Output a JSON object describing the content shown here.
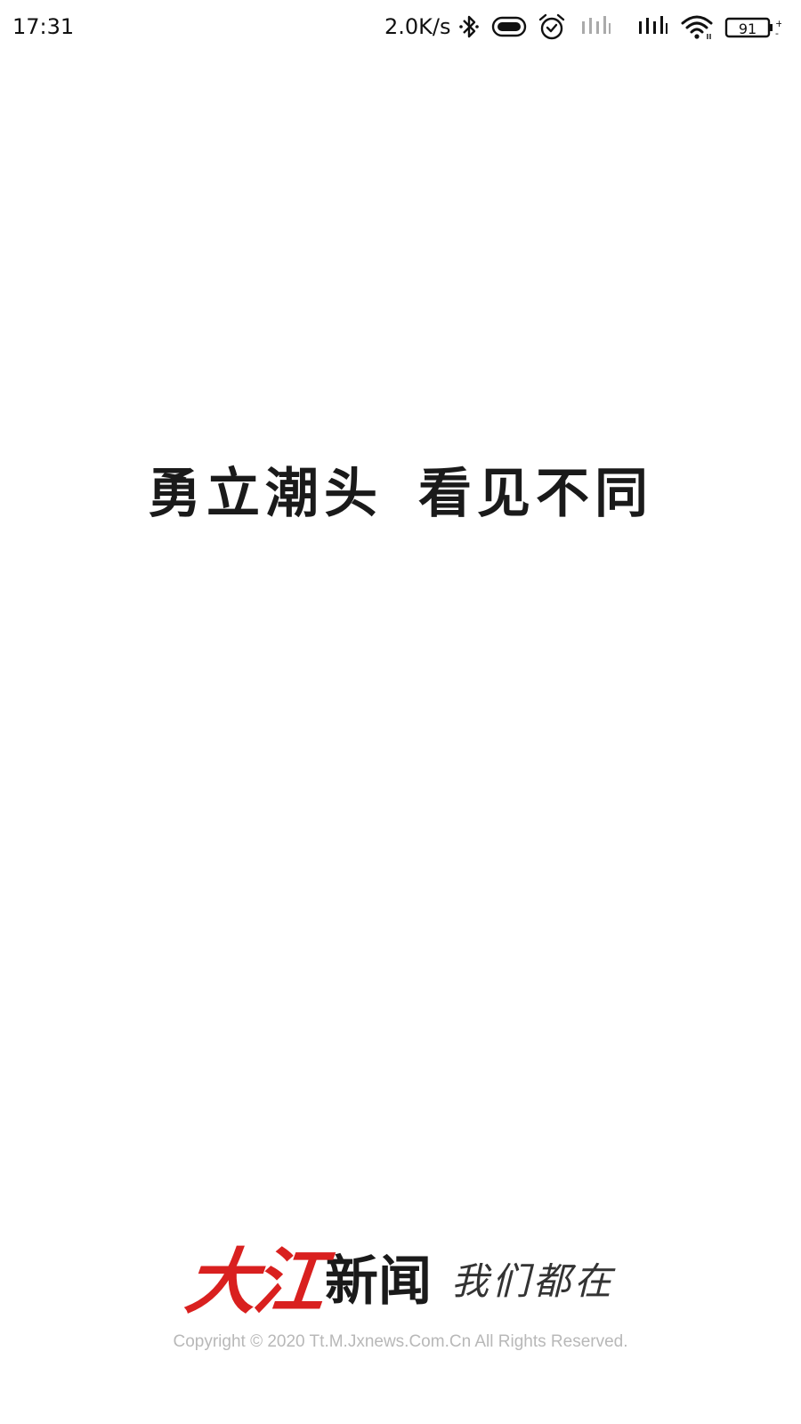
{
  "status_bar": {
    "time": "17:31",
    "network_speed": "2.0K/s",
    "battery_level": "91",
    "icons": [
      "bluetooth-icon",
      "toggle-pill-icon",
      "alarm-clock-icon",
      "signal-sim1-icon",
      "signal-sim2-icon",
      "wifi-icon",
      "battery-icon"
    ]
  },
  "splash": {
    "slogan_left": "勇立潮头",
    "slogan_right": "看见不同"
  },
  "brand": {
    "logo_text": "大江",
    "name": "新闻",
    "tagline": "我们都在",
    "copyright": "Copyright  © 2020 Tt.M.Jxnews.Com.Cn All Rights Reserved."
  },
  "colors": {
    "background": "#ffffff",
    "brand_red": "#d9201f",
    "text_dark": "#1a1a1a",
    "copyright_gray": "#b8b8b8"
  }
}
